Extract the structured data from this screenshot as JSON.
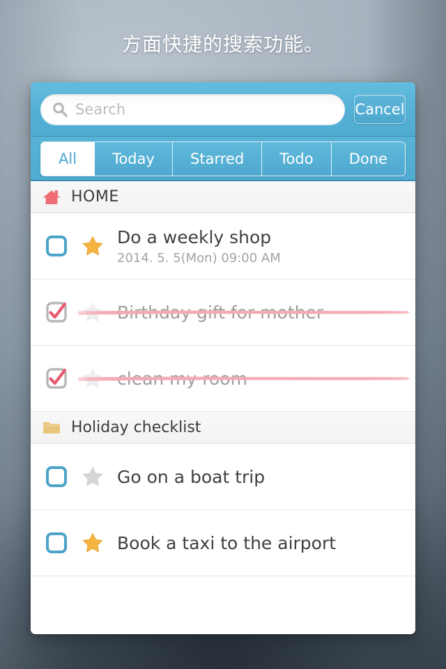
{
  "caption": "方面快捷的搜索功能。",
  "colors": {
    "header_blue": "#55b0d5",
    "accent_blue": "#4ea8cf",
    "checkbox_blue": "#4ca3c8",
    "star_orange": "#f5b43f",
    "star_gray": "#d6d6d6",
    "home_pink": "#ef6e76",
    "folder_tan": "#e8c57a",
    "strike_pink": "#f4aab4",
    "check_pink": "#e8596f"
  },
  "search": {
    "icon": "search-icon",
    "placeholder": "Search",
    "value": "",
    "cancel_label": "Cancel"
  },
  "tabs": [
    {
      "label": "All",
      "active": true
    },
    {
      "label": "Today",
      "active": false
    },
    {
      "label": "Starred",
      "active": false
    },
    {
      "label": "Todo",
      "active": false
    },
    {
      "label": "Done",
      "active": false
    }
  ],
  "sections": [
    {
      "label": "HOME",
      "icon": "home-icon",
      "tasks": [
        {
          "title": "Do a weekly shop",
          "subtitle": "2014. 5. 5(Mon) 09:00 AM",
          "checked": false,
          "starred": true
        },
        {
          "title": "Birthday gift for mother",
          "subtitle": "",
          "checked": true,
          "starred": false
        },
        {
          "title": "clean my room",
          "subtitle": "",
          "checked": true,
          "starred": false
        }
      ]
    },
    {
      "label": "Holiday checklist",
      "icon": "folder-icon",
      "tasks": [
        {
          "title": "Go on a boat trip",
          "subtitle": "",
          "checked": false,
          "starred": false
        },
        {
          "title": "Book a taxi to the airport",
          "subtitle": "",
          "checked": false,
          "starred": true
        }
      ]
    }
  ]
}
